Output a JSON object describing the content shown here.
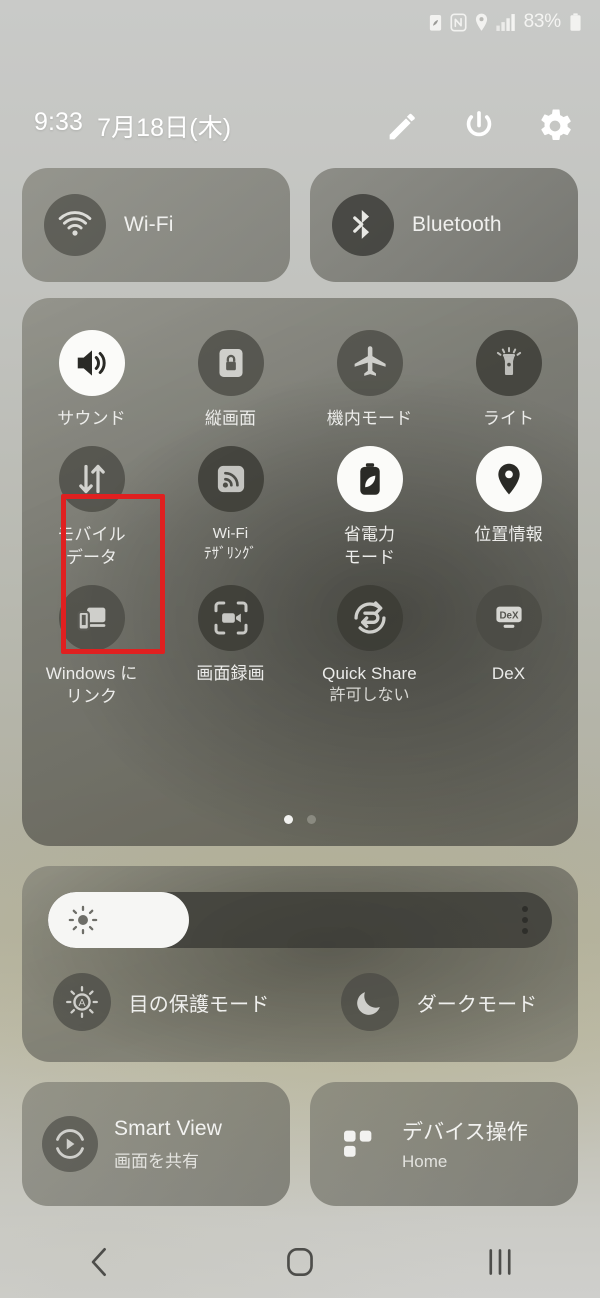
{
  "status_bar": {
    "icons": [
      "power-saving-battery-icon",
      "nfc-icon",
      "location-pin-icon",
      "signal-bars-icon"
    ],
    "battery_percent": "83%",
    "battery_icon": "battery-icon"
  },
  "header": {
    "time": "9:33",
    "date": "7月18日(木)",
    "actions": [
      {
        "name": "edit-pencil-icon",
        "label": "edit"
      },
      {
        "name": "power-icon",
        "label": "power"
      },
      {
        "name": "settings-gear-icon",
        "label": "settings"
      }
    ]
  },
  "connection_pills": [
    {
      "label": "Wi-Fi",
      "icon": "wifi-icon",
      "active": false
    },
    {
      "label": "Bluetooth",
      "icon": "bluetooth-icon",
      "active": false
    }
  ],
  "toggles": [
    {
      "label": "サウンド",
      "sub": "",
      "icon": "sound-icon",
      "state": "on"
    },
    {
      "label": "縦画面",
      "sub": "",
      "icon": "rotation-lock-icon",
      "state": "off"
    },
    {
      "label": "機内モード",
      "sub": "",
      "icon": "airplane-icon",
      "state": "off"
    },
    {
      "label": "ライト",
      "sub": "",
      "icon": "flashlight-icon",
      "state": "off"
    },
    {
      "label": "モバイル\nデータ",
      "sub": "",
      "icon": "mobile-data-icon",
      "state": "off"
    },
    {
      "label": "Wi-Fi\nﾃｻﾞﾘﾝｸﾞ",
      "sub": "",
      "icon": "hotspot-icon",
      "state": "off"
    },
    {
      "label": "省電力\nモード",
      "sub": "",
      "icon": "power-saving-icon",
      "state": "on"
    },
    {
      "label": "位置情報",
      "sub": "",
      "icon": "location-icon",
      "state": "on"
    },
    {
      "label": "Windows に\nリンク",
      "sub": "",
      "icon": "link-to-windows-icon",
      "state": "off"
    },
    {
      "label": "画面録画",
      "sub": "",
      "icon": "screen-record-icon",
      "state": "off"
    },
    {
      "label": "Quick Share",
      "sub": "許可しない",
      "icon": "quick-share-icon",
      "state": "off"
    },
    {
      "label": "DeX",
      "sub": "",
      "icon": "dex-icon",
      "state": "off"
    }
  ],
  "highlight": {
    "target_label": "モバイルデータ",
    "color": "#e02020"
  },
  "page_indicator": {
    "total": 2,
    "current": 1
  },
  "brightness": {
    "icon": "brightness-sun-icon",
    "value_percent": 28,
    "menu_icon": "kebab-menu-icon"
  },
  "display_modes": [
    {
      "label": "目の保護モード",
      "icon": "eye-comfort-icon"
    },
    {
      "label": "ダークモード",
      "icon": "dark-mode-moon-icon"
    }
  ],
  "bottom_pills": [
    {
      "title": "Smart View",
      "subtitle": "画面を共有",
      "icon": "smart-view-icon"
    },
    {
      "title": "デバイス操作",
      "subtitle": "Home",
      "icon": "device-control-icon"
    }
  ],
  "nav_bar": [
    {
      "name": "back-icon",
      "label": "back"
    },
    {
      "name": "home-icon",
      "label": "home"
    },
    {
      "name": "recents-icon",
      "label": "recents"
    }
  ]
}
